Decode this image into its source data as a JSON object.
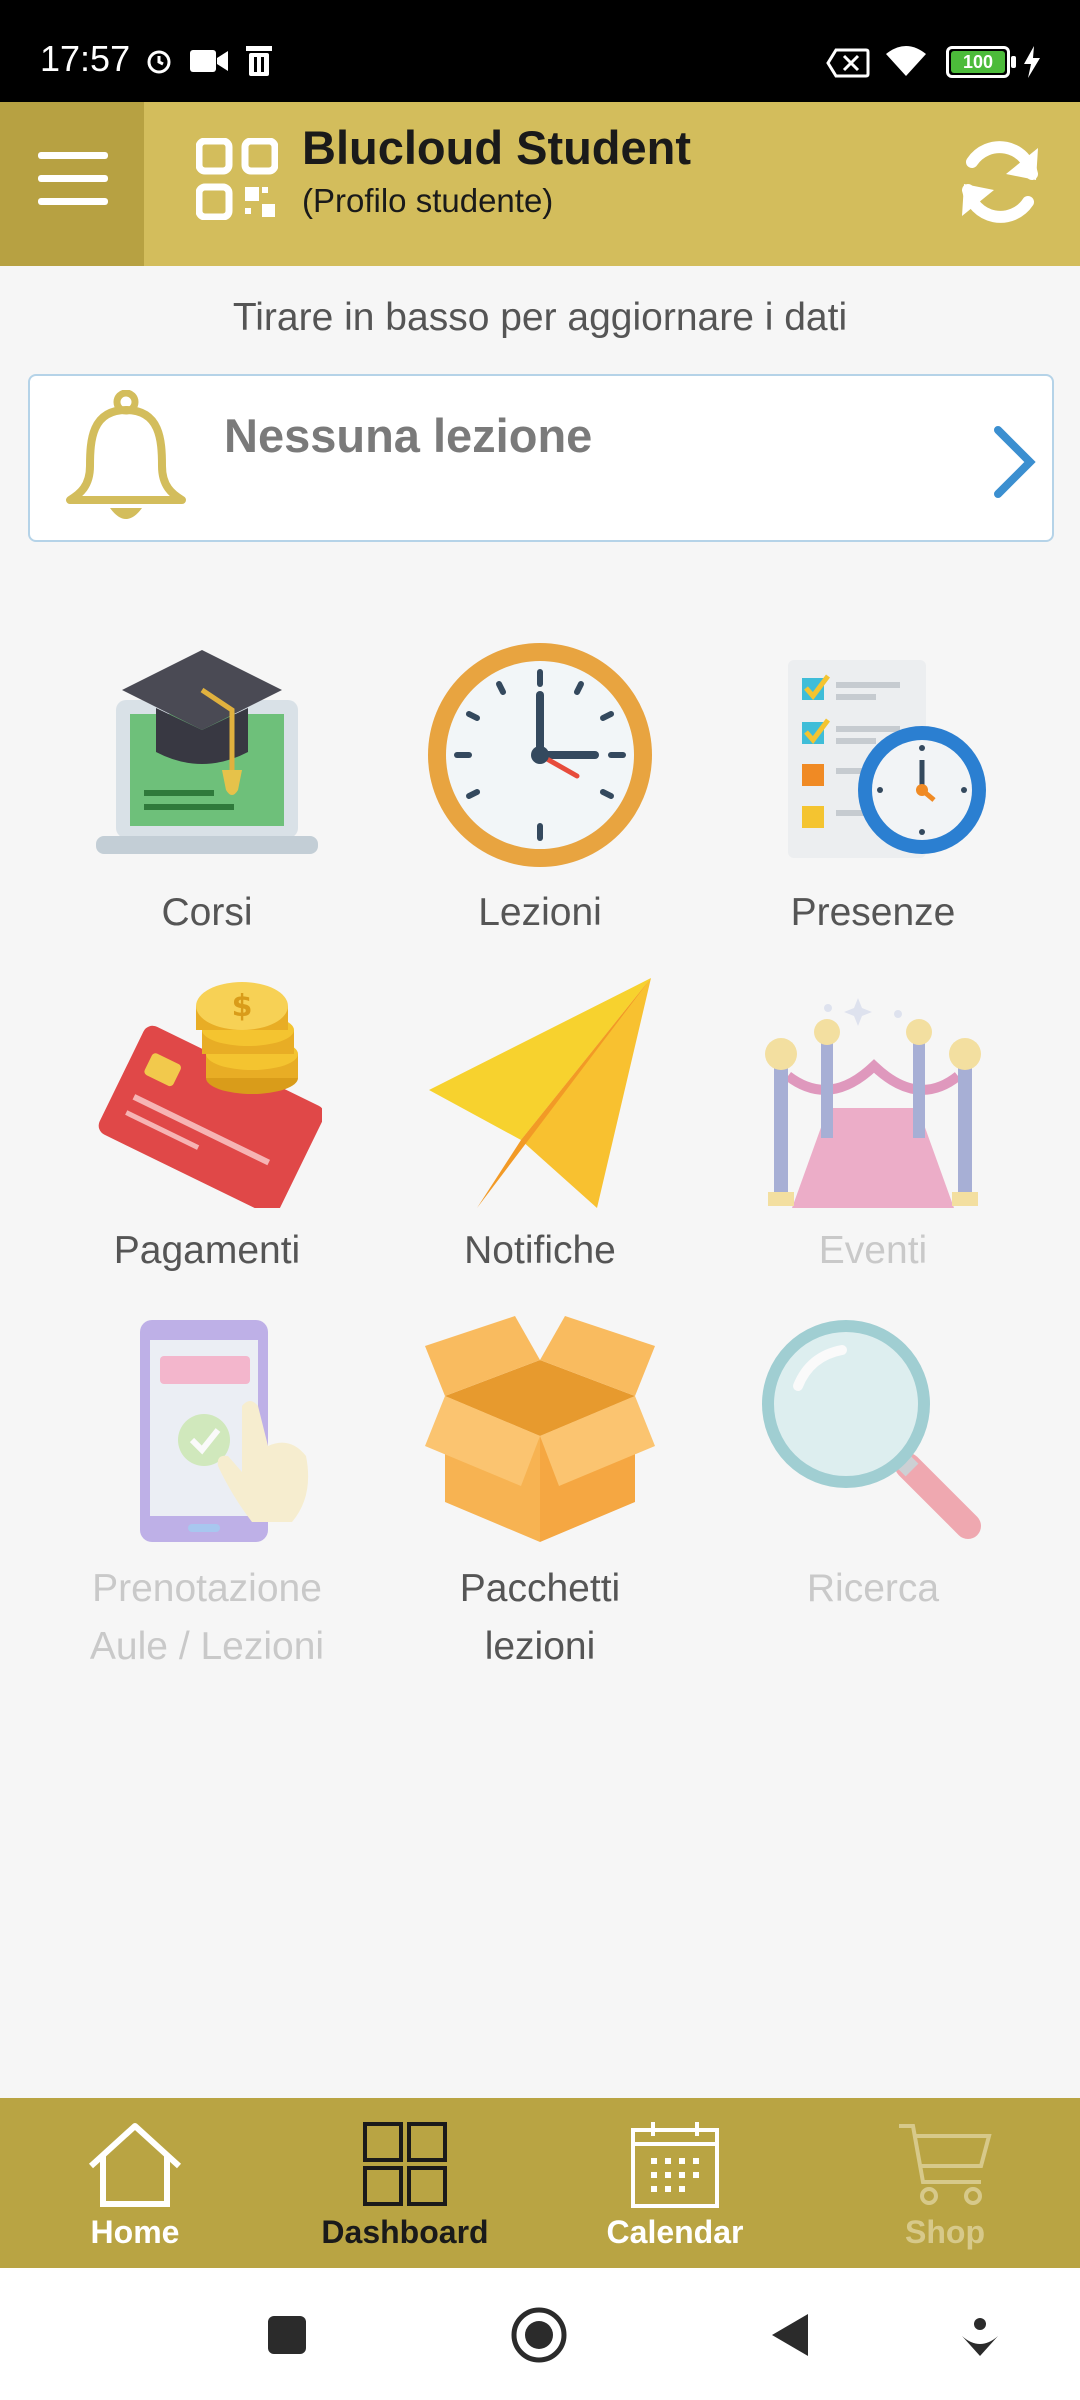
{
  "status_bar": {
    "time": "17:57",
    "battery": "100",
    "icons": [
      "alarm-icon",
      "video-icon",
      "trash-icon",
      "no-sim-icon",
      "wifi-icon",
      "battery-icon",
      "charging-icon"
    ]
  },
  "header": {
    "title": "Blucloud Student",
    "subtitle": "(Profilo studente)",
    "menu_icon": "hamburger-icon",
    "logo_icon": "qr-code-icon",
    "refresh_icon": "refresh-icon",
    "background_color": "#d3bd5c"
  },
  "hint": "Tirare in basso per aggiornare i dati",
  "notice": {
    "label": "Nessuna lezione",
    "icon": "bell-icon",
    "arrow_icon": "chevron-right-icon"
  },
  "tiles": [
    {
      "label": "Corsi",
      "icon": "graduation-laptop-icon",
      "enabled": true
    },
    {
      "label": "Lezioni",
      "icon": "clock-icon",
      "enabled": true
    },
    {
      "label": "Presenze",
      "icon": "checklist-clock-icon",
      "enabled": true
    },
    {
      "label": "Pagamenti",
      "icon": "credit-card-coins-icon",
      "enabled": true
    },
    {
      "label": "Notifiche",
      "icon": "paper-plane-icon",
      "enabled": true
    },
    {
      "label": "Eventi",
      "icon": "red-carpet-icon",
      "enabled": false
    },
    {
      "label_line1": "Prenotazione",
      "label_line2": "Aule / Lezioni",
      "icon": "phone-booking-icon",
      "enabled": false
    },
    {
      "label_line1": "Pacchetti",
      "label_line2": "lezioni",
      "icon": "open-box-icon",
      "enabled": true
    },
    {
      "label": "Ricerca",
      "icon": "magnifier-icon",
      "enabled": false
    }
  ],
  "bottom_nav": {
    "items": [
      {
        "label": "Home",
        "icon": "home-icon",
        "state": "normal"
      },
      {
        "label": "Dashboard",
        "icon": "dashboard-grid-icon",
        "state": "active"
      },
      {
        "label": "Calendar",
        "icon": "calendar-icon",
        "state": "normal"
      },
      {
        "label": "Shop",
        "icon": "cart-icon",
        "state": "disabled"
      }
    ],
    "background_color": "#b9a443"
  },
  "system_nav": [
    "square-button-icon",
    "home-circle-icon",
    "back-triangle-icon",
    "assist-icon"
  ]
}
